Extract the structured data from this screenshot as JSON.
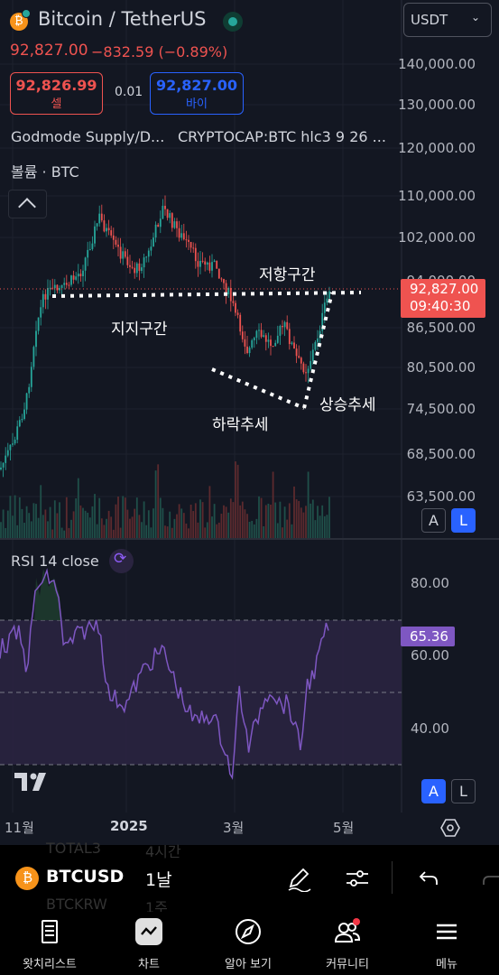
{
  "header": {
    "symbol_name": "Bitcoin / TetherUS",
    "last_price": "92,827.00",
    "change": "−832.59 (−0.89%)",
    "currency_select": "USDT"
  },
  "trade": {
    "sell_price": "92,826.99",
    "sell_label": "셀",
    "spread": "0.01",
    "buy_price": "92,827.00",
    "buy_label": "바이"
  },
  "indicators": {
    "godmode": "Godmode Supply/D...",
    "cryptocap": "CRYPTOCAP:BTC hlc3 9 26 ...",
    "volume": "볼륨 · BTC"
  },
  "price_axis": {
    "ticks": [
      "140,000.00",
      "130,000.00",
      "120,000.00",
      "110,000.00",
      "102,000.00",
      "94,000.00",
      "86,500.00",
      "80,500.00",
      "74,500.00",
      "68,500.00",
      "63,500.00"
    ],
    "current_price": "92,827.00",
    "countdown": "09:40:30"
  },
  "annotations": {
    "resistance": "저항구간",
    "support": "지지구간",
    "downtrend": "하락추세",
    "uptrend": "상승추세"
  },
  "scale_buttons": {
    "auto": "A",
    "log": "L"
  },
  "rsi": {
    "label": "RSI 14 close",
    "value": "65.36",
    "ticks": [
      "80.00",
      "60.00",
      "40.00"
    ]
  },
  "time_axis": {
    "labels": [
      "11월",
      "2025",
      "3월",
      "5월"
    ]
  },
  "toolbar": {
    "symbol": "BTCUSD",
    "ghost_symbol_top": "TOTAL3",
    "ghost_symbol_bottom": "BTCKRW",
    "interval": "1날",
    "ghost_interval_top": "4시간",
    "ghost_interval_bottom": "1주"
  },
  "nav": {
    "items": [
      {
        "label": "왓치리스트",
        "icon": "watchlist-icon"
      },
      {
        "label": "차트",
        "icon": "chart-icon"
      },
      {
        "label": "알아 보기",
        "icon": "explore-icon"
      },
      {
        "label": "커뮤니티",
        "icon": "community-icon"
      },
      {
        "label": "메뉴",
        "icon": "menu-icon"
      }
    ]
  },
  "colors": {
    "background": "#131722",
    "up": "#26a69a",
    "down": "#ef5350",
    "accent_blue": "#2962ff",
    "rsi_line": "#7e57c2"
  }
}
